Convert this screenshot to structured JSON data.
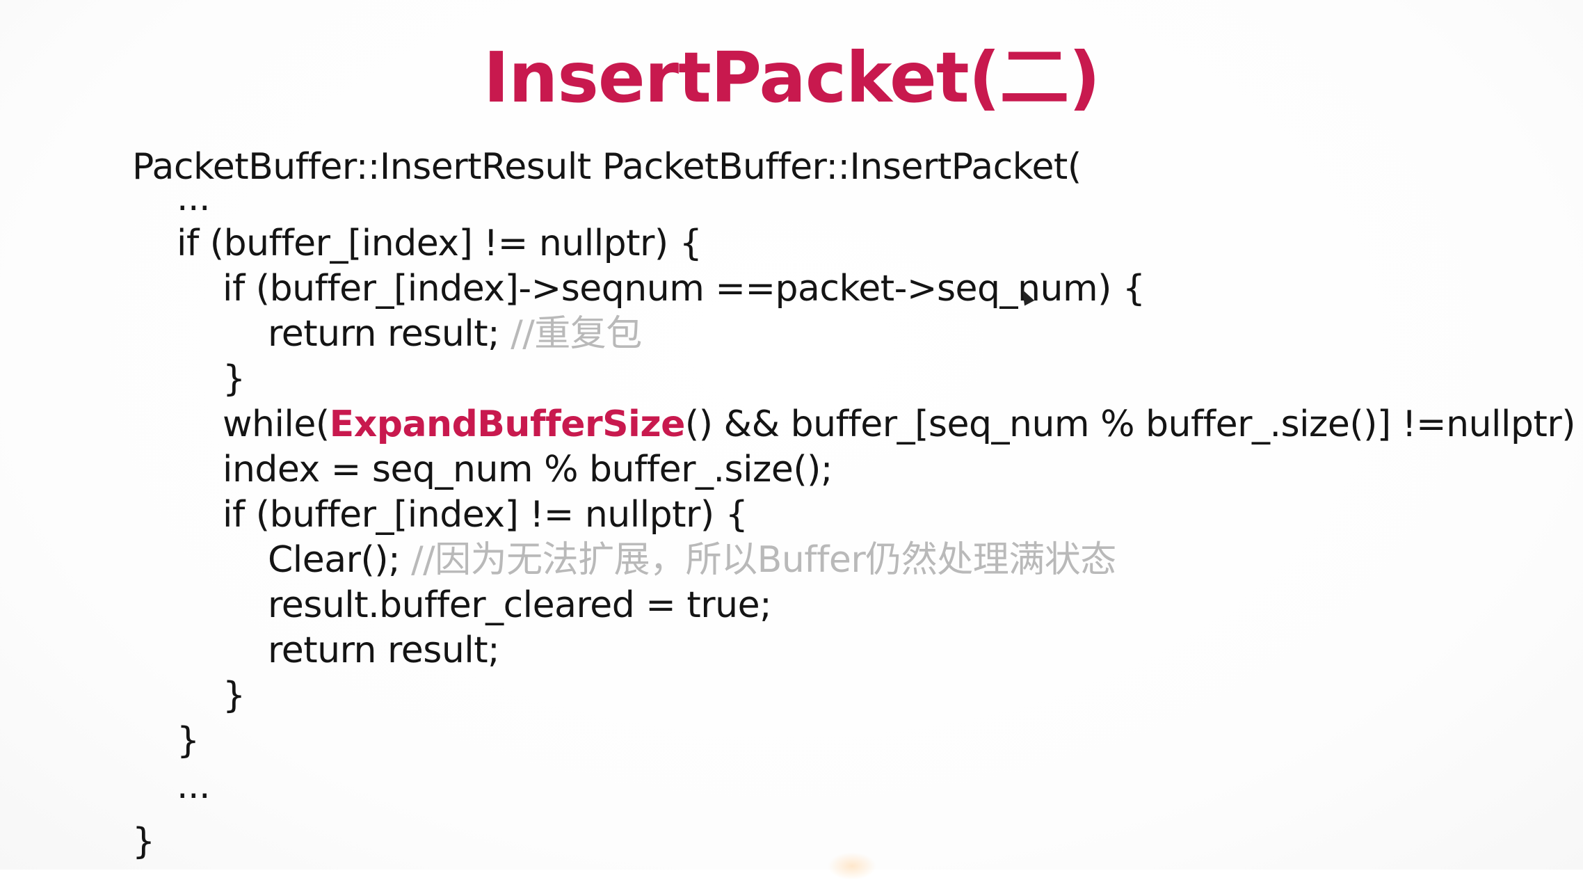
{
  "slide": {
    "title": "InsertPacket(二)"
  },
  "code": {
    "l1": "PacketBuffer::InsertResult PacketBuffer::InsertPacket(",
    "l2": "...",
    "l3": "if (buffer_[index] != nullptr) {",
    "l4": "if (buffer_[index]->seqnum ==packet->seq_num) {",
    "l5_code": "return result; ",
    "l5_comment": "//重复包",
    "l6": "}",
    "l7_pre": "while(",
    "l7_fn": "ExpandBufferSize",
    "l7_post": "() && buffer_[seq_num % buffer_.size()] !=nullptr) {}",
    "l8": "index = seq_num % buffer_.size();",
    "l9": "if (buffer_[index] != nullptr) {",
    "l10_code": "Clear(); ",
    "l10_comment": "//因为无法扩展，所以Buffer仍然处理满状态",
    "l11": "result.buffer_cleared = true;",
    "l12": "return result;",
    "l13": "}",
    "l14": "}",
    "l15": "...",
    "l16": "}"
  },
  "colors": {
    "accent": "#c8194e",
    "text": "#141414",
    "comment": "#b9b9b9",
    "background": "#ffffff"
  },
  "icons": {
    "cursor": "mouse-pointer-icon"
  }
}
